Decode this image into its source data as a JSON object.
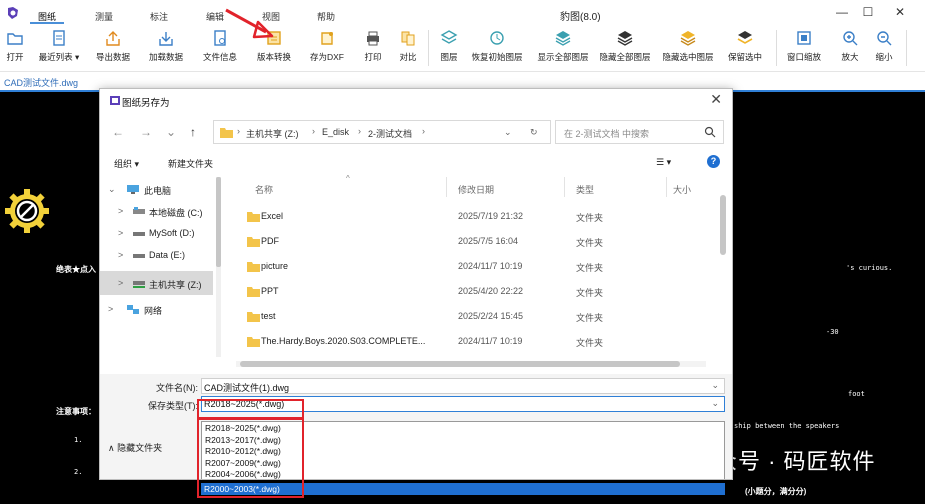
{
  "app": {
    "title": "豹图(8.0)",
    "menu_tabs": [
      "图纸",
      "测量",
      "标注",
      "编辑",
      "视图",
      "帮助"
    ],
    "window_controls": [
      "—",
      "☐",
      "✕"
    ]
  },
  "toolbar": {
    "items": [
      {
        "label": "打开",
        "icon": "folder-open-icon"
      },
      {
        "label": "最近列表 ▾",
        "icon": "recent-list-icon"
      },
      {
        "label": "导出数据",
        "icon": "export-icon"
      },
      {
        "label": "加载数据",
        "icon": "import-icon"
      },
      {
        "label": "文件信息",
        "icon": "file-info-icon"
      },
      {
        "label": "版本转换",
        "icon": "version-convert-icon"
      },
      {
        "label": "存为DXF",
        "icon": "save-dxf-icon"
      },
      {
        "label": "打印",
        "icon": "printer-icon"
      },
      {
        "label": "对比",
        "icon": "compare-icon"
      },
      {
        "label": "图层",
        "icon": "layer-icon"
      },
      {
        "label": "恢复初始图层",
        "icon": "restore-layer-icon"
      },
      {
        "label": "显示全部图层",
        "icon": "show-layers-icon"
      },
      {
        "label": "隐藏全部图层",
        "icon": "hide-layers-icon"
      },
      {
        "label": "隐藏选中图层",
        "icon": "hide-selected-layer-icon"
      },
      {
        "label": "保留选中",
        "icon": "keep-selected-icon"
      },
      {
        "label": "窗口缩放",
        "icon": "window-zoom-icon"
      },
      {
        "label": "放大",
        "icon": "zoom-in-icon"
      },
      {
        "label": "缩小",
        "icon": "zoom-out-icon"
      }
    ]
  },
  "file_tab": "CAD测试文件.dwg",
  "canvas": {
    "texts": [
      {
        "text": "绝表★点入",
        "style": "bold"
      },
      {
        "text": "'s curious.",
        "style": "mono"
      },
      {
        "text": "-30",
        "style": "mono"
      },
      {
        "text": "foot",
        "style": "mono"
      },
      {
        "text": "注意事项：",
        "style": "bold"
      },
      {
        "text": "ship between the speakers",
        "style": "mono"
      },
      {
        "text": "1.",
        "style": "mono"
      },
      {
        "text": "2.",
        "style": "mono"
      },
      {
        "text": "(小题分，满分分)",
        "style": "bold"
      }
    ],
    "watermark": "公众号 · 码匠软件"
  },
  "dialog": {
    "title": "图纸另存为",
    "close": "✕",
    "nav": {
      "back": "←",
      "forward": "→",
      "dropdown": "⌄",
      "up": "↑",
      "refresh": "↻"
    },
    "address_parts": [
      "主机共享 (Z:)",
      "E_disk",
      "2-测试文档"
    ],
    "address_chevron": "⌄",
    "search_placeholder": "在 2-测试文档 中搜索",
    "commands": {
      "organize": "组织 ▾",
      "new_folder": "新建文件夹",
      "view": "☰ ▾",
      "help": "?"
    },
    "tree": [
      {
        "label": "此电脑",
        "chevron": "⌄",
        "icon": "computer-icon"
      },
      {
        "label": "本地磁盘 (C:)",
        "chevron": ">",
        "icon": "drive-icon"
      },
      {
        "label": "MySoft (D:)",
        "chevron": ">",
        "icon": "drive-icon"
      },
      {
        "label": "Data (E:)",
        "chevron": ">",
        "icon": "drive-icon"
      },
      {
        "label": "主机共享 (Z:)",
        "chevron": ">",
        "icon": "network-drive-icon"
      },
      {
        "label": "网络",
        "chevron": ">",
        "icon": "network-icon"
      }
    ],
    "columns": [
      "名称",
      "修改日期",
      "类型",
      "大小"
    ],
    "files": [
      {
        "name": "Excel",
        "date": "2025/7/19 21:32",
        "type": "文件夹"
      },
      {
        "name": "PDF",
        "date": "2025/7/5 16:04",
        "type": "文件夹"
      },
      {
        "name": "picture",
        "date": "2024/11/7 10:19",
        "type": "文件夹"
      },
      {
        "name": "PPT",
        "date": "2025/4/20 22:22",
        "type": "文件夹"
      },
      {
        "name": "test",
        "date": "2025/2/24 15:45",
        "type": "文件夹"
      },
      {
        "name": "The.Hardy.Boys.2020.S03.COMPLETE...",
        "date": "2024/11/7 10:19",
        "type": "文件夹"
      }
    ],
    "filename_label": "文件名(N):",
    "filename_value": "CAD测试文件(1).dwg",
    "savetype_label": "保存类型(T):",
    "savetype_value": "R2018~2025(*.dwg)",
    "savetype_options": [
      "R2018~2025(*.dwg)",
      "R2013~2017(*.dwg)",
      "R2010~2012(*.dwg)",
      "R2007~2009(*.dwg)",
      "R2004~2006(*.dwg)",
      "R2000~2003(*.dwg)"
    ],
    "hide_folders": "隐藏文件夹",
    "dropdown_chevron": "⌄"
  },
  "colors": {
    "accent": "#2f7fd6",
    "highlight": "#e1232b",
    "canvas_bg": "#000000"
  }
}
